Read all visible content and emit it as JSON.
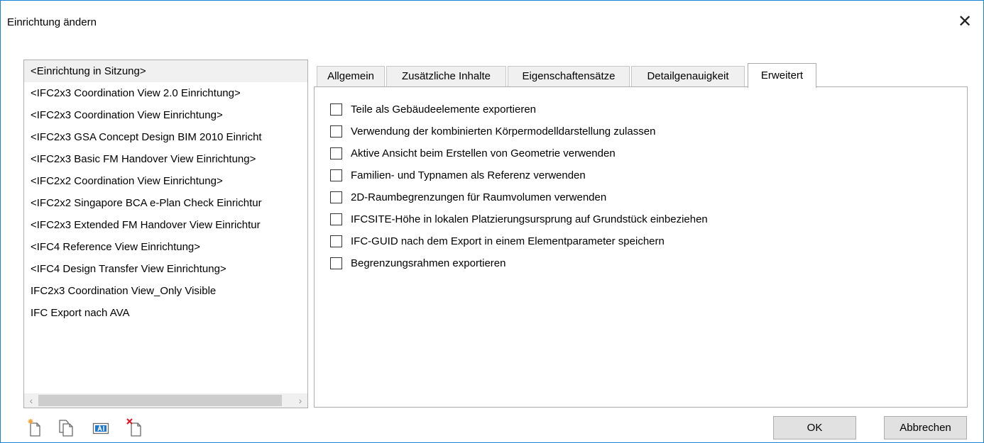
{
  "window": {
    "title": "Einrichtung ändern",
    "close_label": "✕"
  },
  "setups": [
    "<Einrichtung in Sitzung>",
    "<IFC2x3 Coordination View 2.0 Einrichtung>",
    "<IFC2x3 Coordination View Einrichtung>",
    "<IFC2x3 GSA Concept Design BIM 2010 Einricht",
    "<IFC2x3 Basic FM Handover View Einrichtung>",
    "<IFC2x2 Coordination View Einrichtung>",
    "<IFC2x2 Singapore BCA e-Plan Check Einrichtur",
    "<IFC2x3 Extended FM Handover View Einrichtur",
    "<IFC4 Reference View Einrichtung>",
    "<IFC4 Design Transfer View Einrichtung>",
    "IFC2x3 Coordination View_Only Visible",
    "IFC Export nach AVA"
  ],
  "selected_setup": "<Einrichtung in Sitzung>",
  "scrollbar": {
    "left_arrow": "‹",
    "right_arrow": "›"
  },
  "tabs": [
    "Allgemein",
    "Zusätzliche Inhalte",
    "Eigenschaftensätze",
    "Detailgenauigkeit",
    "Erweitert"
  ],
  "active_tab": "Erweitert",
  "options": [
    {
      "label": "Teile als Gebäudeelemente exportieren",
      "checked": false
    },
    {
      "label": "Verwendung der kombinierten Körpermodelldarstellung zulassen",
      "checked": false
    },
    {
      "label": "Aktive Ansicht beim Erstellen von Geometrie verwenden",
      "checked": false
    },
    {
      "label": "Familien- und Typnamen als Referenz verwenden",
      "checked": false
    },
    {
      "label": "2D-Raumbegrenzungen für Raumvolumen verwenden",
      "checked": false
    },
    {
      "label": "IFCSITE-Höhe in lokalen Platzierungsursprung auf Grundstück einbeziehen",
      "checked": false
    },
    {
      "label": "IFC-GUID nach dem Export in einem Elementparameter speichern",
      "checked": false
    },
    {
      "label": "Begrenzungsrahmen exportieren",
      "checked": false
    }
  ],
  "toolbar": {
    "icons": [
      "new-setup-icon",
      "duplicate-setup-icon",
      "rename-setup-icon",
      "delete-setup-icon"
    ]
  },
  "buttons": {
    "ok": "OK",
    "cancel": "Abbrechen"
  },
  "colors": {
    "window_border": "#1883d7",
    "selected_row": "#f0f0f0",
    "button_face": "#e1e1e1",
    "icon_red": "#e81123",
    "icon_blue": "#1e78d2"
  }
}
